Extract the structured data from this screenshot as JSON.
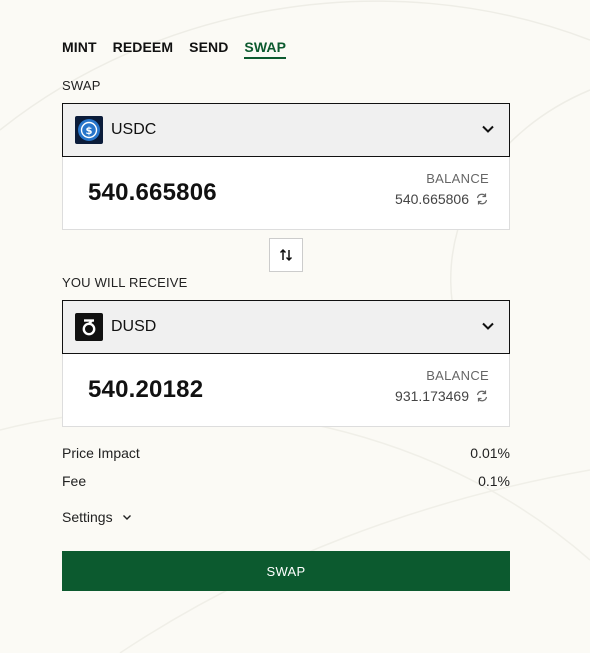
{
  "tabs": [
    {
      "label": "MINT",
      "active": false
    },
    {
      "label": "REDEEM",
      "active": false
    },
    {
      "label": "SEND",
      "active": false
    },
    {
      "label": "SWAP",
      "active": true
    }
  ],
  "from": {
    "section_label": "SWAP",
    "token": "USDC",
    "icon": "usdc-logo-icon",
    "amount": "540.665806",
    "balance_label": "BALANCE",
    "balance": "540.665806"
  },
  "to": {
    "section_label": "YOU WILL RECEIVE",
    "token": "DUSD",
    "icon": "dusd-logo-icon",
    "amount": "540.20182",
    "balance_label": "BALANCE",
    "balance": "931.173469"
  },
  "details": {
    "price_impact_label": "Price Impact",
    "price_impact_value": "0.01%",
    "fee_label": "Fee",
    "fee_value": "0.1%",
    "settings_label": "Settings"
  },
  "action": {
    "swap_label": "SWAP"
  },
  "colors": {
    "accent": "#0c5a2f",
    "usdc": "#2775ca",
    "background": "#fbfaf5"
  }
}
